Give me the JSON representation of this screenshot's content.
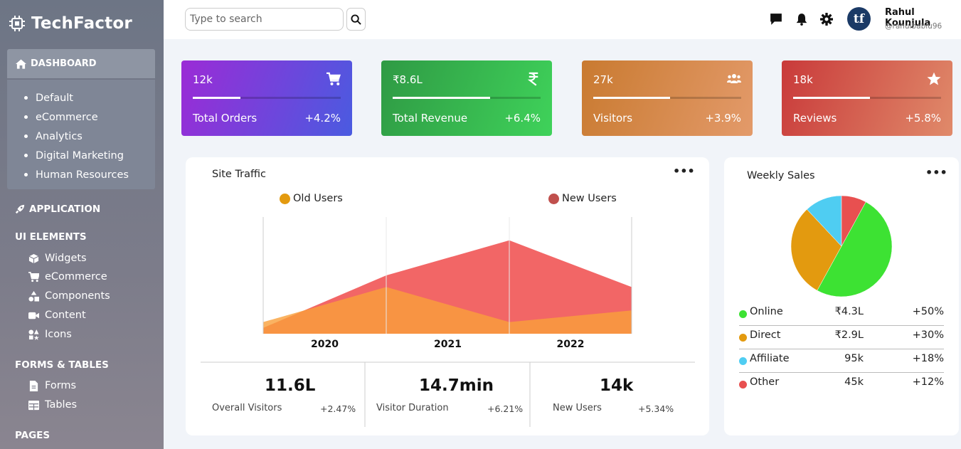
{
  "brand": {
    "name": "TechFactor"
  },
  "sidebar": {
    "dashboard_label": "DASHBOARD",
    "dashboard_items": [
      "Default",
      "eCommerce",
      "Analytics",
      "Digital Marketing",
      "Human Resources"
    ],
    "application_label": "APPLICATION",
    "ui_elements_label": "UI ELEMENTS",
    "ui_items": [
      {
        "label": "Widgets",
        "icon": "cube-icon"
      },
      {
        "label": "eCommerce",
        "icon": "cart-icon"
      },
      {
        "label": "Components",
        "icon": "shapes-icon"
      },
      {
        "label": "Content",
        "icon": "video-icon"
      },
      {
        "label": "Icons",
        "icon": "icons-icon"
      }
    ],
    "forms_tables_label": "FORMS & TABLES",
    "forms_items": [
      {
        "label": "Forms",
        "icon": "file-icon"
      },
      {
        "label": "Tables",
        "icon": "table-icon"
      }
    ],
    "pages_label": "PAGES"
  },
  "header": {
    "search_placeholder": "Type to search",
    "user_name": "Rahul Kounjula",
    "user_handle": "@rahulbablu96",
    "avatar_initials": "tf"
  },
  "stats": [
    {
      "value": "12k",
      "label": "Total Orders",
      "change": "+4.2%",
      "icon": "cart-icon",
      "progress": 0.32,
      "from": "#9b2bd6",
      "to": "#4a5be0"
    },
    {
      "value": "₹8.6L",
      "label": "Total Revenue",
      "change": "+6.4%",
      "icon": "rupee-icon",
      "progress": 0.66,
      "from": "#2f9a44",
      "to": "#3fd25a"
    },
    {
      "value": "27k",
      "label": "Visitors",
      "change": "+3.9%",
      "icon": "users-icon",
      "progress": 0.52,
      "from": "#c97a30",
      "to": "#e39a6a"
    },
    {
      "value": "18k",
      "label": "Reviews",
      "change": "+5.8%",
      "icon": "star-icon",
      "progress": 0.52,
      "from": "#c93a3a",
      "to": "#e08a6a"
    }
  ],
  "site_traffic": {
    "title": "Site Traffic",
    "stats": [
      {
        "value": "11.6L",
        "label": "Overall Visitors",
        "change": "+2.47%"
      },
      {
        "value": "14.7min",
        "label": "Visitor Duration",
        "change": "+6.21%"
      },
      {
        "value": "14k",
        "label": "New Users",
        "change": "+5.34%"
      }
    ]
  },
  "weekly_sales": {
    "title": "Weekly Sales",
    "rows": [
      {
        "name": "Online",
        "amount": "₹4.3L",
        "change": "+50%",
        "color": "#3de233"
      },
      {
        "name": "Direct",
        "amount": "₹2.9L",
        "change": "+30%",
        "color": "#e39a0f"
      },
      {
        "name": "Affiliate",
        "amount": "95k",
        "change": "+18%",
        "color": "#4fcdf2"
      },
      {
        "name": "Other",
        "amount": "45k",
        "change": "+12%",
        "color": "#e85050"
      }
    ]
  },
  "chart_data": [
    {
      "type": "area",
      "categories": [
        "2020",
        "2021",
        "2022"
      ],
      "series": [
        {
          "name": "Old Users",
          "color": "#f9a03b",
          "values": [
            1.0,
            4.0,
            1.0,
            2.0
          ]
        },
        {
          "name": "New Users",
          "color": "#f26666",
          "values": [
            0.5,
            5.0,
            8.0,
            4.0
          ]
        }
      ],
      "legend": "top"
    },
    {
      "type": "pie",
      "labels": [
        "Online",
        "Direct",
        "Affiliate",
        "Other"
      ],
      "values": [
        50,
        30,
        12,
        8
      ],
      "colors": [
        "#3de233",
        "#e39a0f",
        "#4fcdf2",
        "#e85050"
      ]
    }
  ]
}
